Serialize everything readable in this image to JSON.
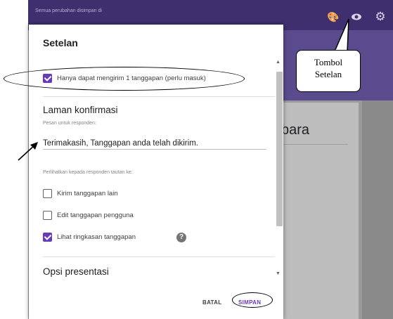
{
  "topbar": {
    "saved_text": "Semua perubahan disimpan di"
  },
  "background_form": {
    "title_fragment": "bara"
  },
  "dialog": {
    "title": "Setelan",
    "settings": [
      {
        "label": "Hanya dapat mengirim 1 tanggapan (perlu masuk)",
        "checked": true
      }
    ],
    "confirmation": {
      "section_title": "Laman konfirmasi",
      "message_label": "Pesan untuk responden:",
      "message_value": "Terimakasih, Tanggapan anda telah dikirim.",
      "show_links_label": "Perlihatkan kepada responden tautan ke:",
      "options": [
        {
          "label": "Kirim tanggapan lain",
          "checked": false
        },
        {
          "label": "Edit tanggapan pengguna",
          "checked": false
        },
        {
          "label": "Lihat ringkasan tanggapan",
          "checked": true
        }
      ],
      "help_glyph": "?"
    },
    "presentation_title": "Opsi presentasi",
    "buttons": {
      "cancel": "BATAL",
      "save": "SIMPAN"
    }
  },
  "annotation": {
    "callout_line1": "Tombol",
    "callout_line2": "Setelan"
  },
  "icons": [
    "palette-icon",
    "eye-icon",
    "gear-icon",
    "arrow-annotation-icon"
  ],
  "colors": {
    "accent": "#673ab7",
    "header": "#3f2f6e"
  }
}
